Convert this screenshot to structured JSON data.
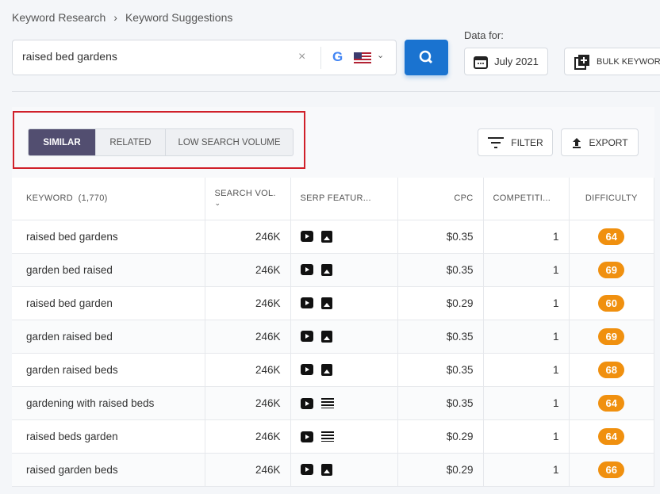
{
  "breadcrumb": {
    "items": [
      "Keyword Research",
      "Keyword Suggestions"
    ],
    "separator": "›"
  },
  "search": {
    "value": "raised bed gardens",
    "clear": "×",
    "engine": "G",
    "country": "US"
  },
  "data_for": {
    "label": "Data for:",
    "date": "July 2021"
  },
  "bulk_label": "BULK KEYWOR",
  "tabs": [
    {
      "label": "SIMILAR",
      "active": true
    },
    {
      "label": "RELATED"
    },
    {
      "label": "LOW SEARCH VOLUME"
    }
  ],
  "filter_label": "FILTER",
  "export_label": "EXPORT",
  "table": {
    "headers": {
      "keyword": "KEYWORD",
      "count": "(1,770)",
      "volume": "SEARCH VOL.",
      "serp": "SERP FEATUR...",
      "cpc": "CPC",
      "competition": "COMPETITI...",
      "difficulty": "DIFFICULTY"
    },
    "rows": [
      {
        "keyword": "raised bed gardens",
        "volume": "246K",
        "serp": [
          "youtube",
          "image"
        ],
        "cpc": "$0.35",
        "competition": "1",
        "difficulty": "64"
      },
      {
        "keyword": "garden bed raised",
        "volume": "246K",
        "serp": [
          "youtube",
          "image"
        ],
        "cpc": "$0.35",
        "competition": "1",
        "difficulty": "69"
      },
      {
        "keyword": "raised bed garden",
        "volume": "246K",
        "serp": [
          "youtube",
          "image"
        ],
        "cpc": "$0.29",
        "competition": "1",
        "difficulty": "60"
      },
      {
        "keyword": "garden raised bed",
        "volume": "246K",
        "serp": [
          "youtube",
          "image"
        ],
        "cpc": "$0.35",
        "competition": "1",
        "difficulty": "69"
      },
      {
        "keyword": "garden raised beds",
        "volume": "246K",
        "serp": [
          "youtube",
          "image"
        ],
        "cpc": "$0.35",
        "competition": "1",
        "difficulty": "68"
      },
      {
        "keyword": "gardening with raised beds",
        "volume": "246K",
        "serp": [
          "youtube",
          "list"
        ],
        "cpc": "$0.35",
        "competition": "1",
        "difficulty": "64"
      },
      {
        "keyword": "raised beds garden",
        "volume": "246K",
        "serp": [
          "youtube",
          "list"
        ],
        "cpc": "$0.29",
        "competition": "1",
        "difficulty": "64"
      },
      {
        "keyword": "raised garden beds",
        "volume": "246K",
        "serp": [
          "youtube",
          "image"
        ],
        "cpc": "$0.29",
        "competition": "1",
        "difficulty": "66"
      }
    ]
  },
  "colors": {
    "primary": "#1a73d0",
    "active_tab": "#524e70",
    "difficulty": "#f0900f",
    "highlight": "#d0202a"
  }
}
